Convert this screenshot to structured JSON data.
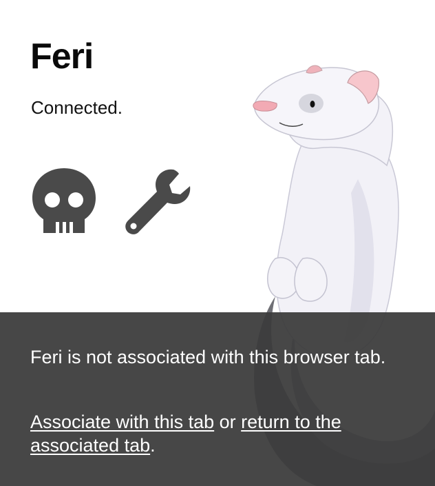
{
  "app": {
    "title": "Feri",
    "status": "Connected."
  },
  "toolbar": {
    "icons": [
      "skull-icon",
      "wrench-icon"
    ],
    "icon_color": "#4a4a4a"
  },
  "overlay": {
    "message": "Feri is not associated with this browser tab.",
    "link_associate": "Associate with this tab",
    "or": " or ",
    "link_return": "return to the associated tab",
    "period": ".",
    "background": "#3c3c3c"
  }
}
